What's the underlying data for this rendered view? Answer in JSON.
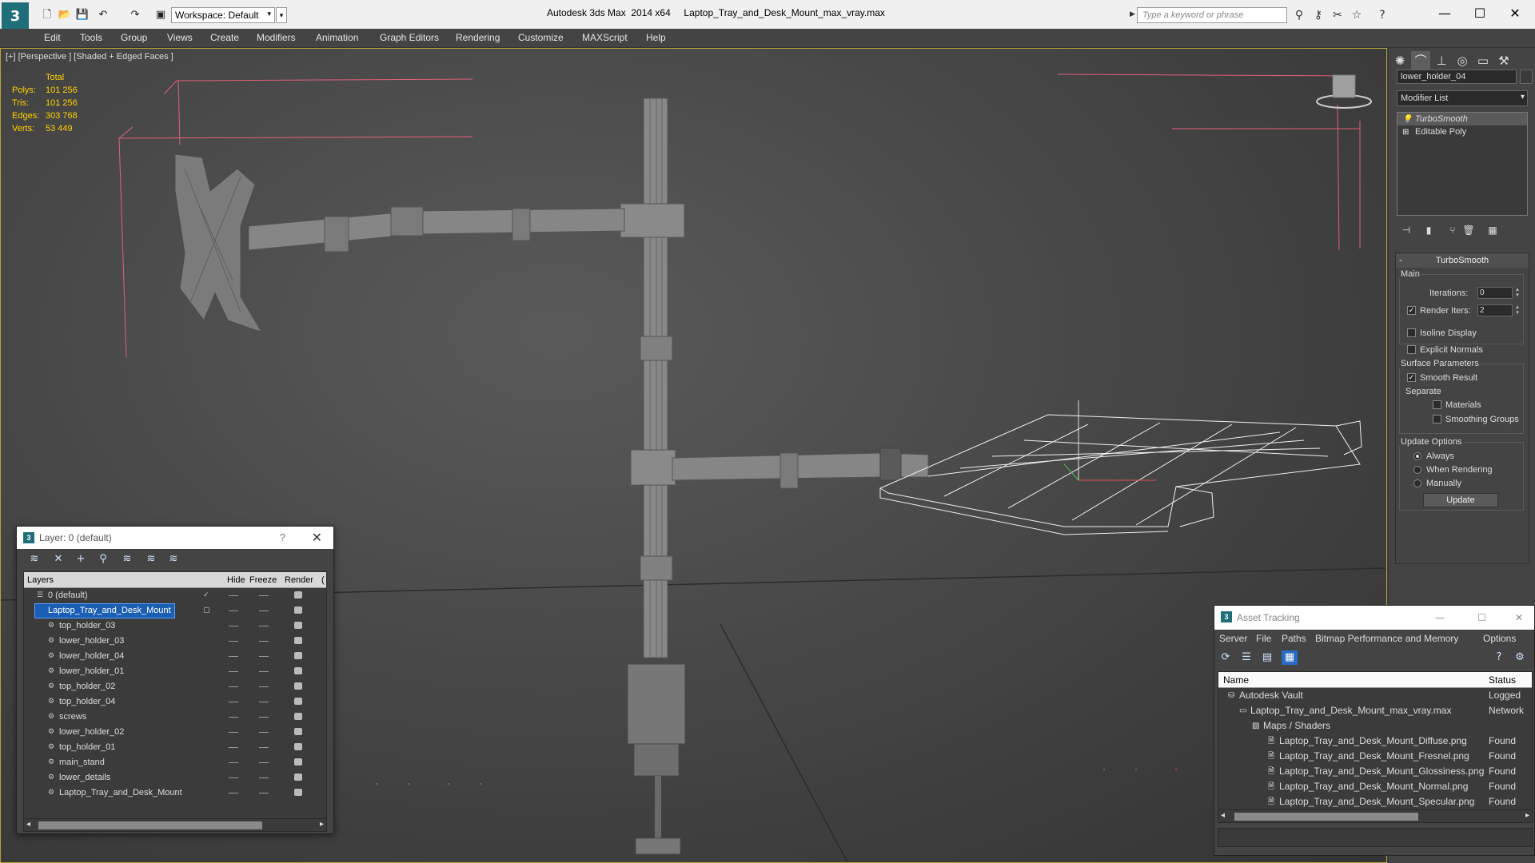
{
  "window": {
    "app_title": "Autodesk 3ds Max  2014 x64     Laptop_Tray_and_Desk_Mount_max_vray.max",
    "workspace": "Workspace: Default",
    "search_placeholder": "Type a keyword or phrase"
  },
  "menu": [
    "Edit",
    "Tools",
    "Group",
    "Views",
    "Create",
    "Modifiers",
    "Animation",
    "Graph Editors",
    "Rendering",
    "Customize",
    "MAXScript",
    "Help"
  ],
  "viewport": {
    "label": "[+] [Perspective ] [Shaded + Edged Faces ]",
    "stats": {
      "total": "Total",
      "rows": [
        {
          "label": "Polys:",
          "value": "101 256"
        },
        {
          "label": "Tris:",
          "value": "101 256"
        },
        {
          "label": "Edges:",
          "value": "303 768"
        },
        {
          "label": "Verts:",
          "value": "53 449"
        }
      ]
    }
  },
  "command_panel": {
    "object_name": "lower_holder_04",
    "modifier_list": "Modifier List",
    "stack": [
      "TurboSmooth",
      "Editable Poly"
    ],
    "rollout_title": "TurboSmooth",
    "main_label": "Main",
    "iterations_label": "Iterations:",
    "iterations_value": "0",
    "render_iters_label": "Render Iters:",
    "render_iters_value": "2",
    "isoline_label": "Isoline Display",
    "explicit_normals_label": "Explicit Normals",
    "surface_params_label": "Surface Parameters",
    "smooth_result_label": "Smooth Result",
    "separate_label": "Separate",
    "materials_label": "Materials",
    "smoothing_groups_label": "Smoothing Groups",
    "update_options_label": "Update Options",
    "always_label": "Always",
    "when_rendering_label": "When Rendering",
    "manually_label": "Manually",
    "update_button": "Update"
  },
  "layer_dialog": {
    "title": "Layer: 0 (default)",
    "help": "?",
    "columns": {
      "layers": "Layers",
      "hide": "Hide",
      "freeze": "Freeze",
      "render": "Render",
      "extra": "("
    },
    "rows": [
      "0 (default)",
      "Laptop_Tray_and_Desk_Mount",
      "top_holder_03",
      "lower_holder_03",
      "lower_holder_04",
      "lower_holder_01",
      "top_holder_02",
      "top_holder_04",
      "screws",
      "lower_holder_02",
      "top_holder_01",
      "main_stand",
      "lower_details",
      "Laptop_Tray_and_Desk_Mount"
    ]
  },
  "asset_dialog": {
    "title": "Asset Tracking",
    "menu": [
      "Server",
      "File",
      "Paths",
      "Bitmap Performance and Memory",
      "Options"
    ],
    "col_name": "Name",
    "col_status": "Status",
    "rows": [
      {
        "name": "Autodesk Vault",
        "status": "Logged"
      },
      {
        "name": "Laptop_Tray_and_Desk_Mount_max_vray.max",
        "status": "Network"
      },
      {
        "name": "Maps / Shaders",
        "status": ""
      },
      {
        "name": "Laptop_Tray_and_Desk_Mount_Diffuse.png",
        "status": "Found"
      },
      {
        "name": "Laptop_Tray_and_Desk_Mount_Fresnel.png",
        "status": "Found"
      },
      {
        "name": "Laptop_Tray_and_Desk_Mount_Glossiness.png",
        "status": "Found"
      },
      {
        "name": "Laptop_Tray_and_Desk_Mount_Normal.png",
        "status": "Found"
      },
      {
        "name": "Laptop_Tray_and_Desk_Mount_Specular.png",
        "status": "Found"
      }
    ]
  },
  "colors": {
    "stats_yellow": "#ffd000",
    "selection_blue": "#1a5fb4",
    "viewport_border": "#b8a23a",
    "bounding_box_pink": "#e0607a"
  }
}
